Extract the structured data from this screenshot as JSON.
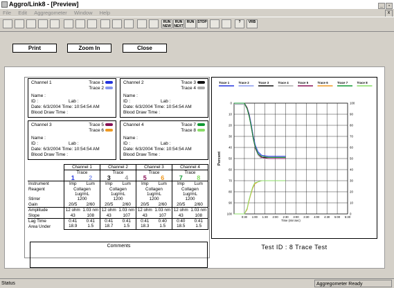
{
  "window": {
    "title": "Aggro/Link8 - [Preview]",
    "minimize": "_",
    "restore": "▫"
  },
  "menu": {
    "items": [
      "File",
      "Edit",
      "Aggregometer",
      "Window",
      "Help"
    ],
    "sys_close": "x"
  },
  "toolbar": {
    "buttons": [
      {
        "icon": "open-folder-icon",
        "label": ""
      },
      {
        "icon": "patient-icon",
        "label": ""
      },
      {
        "icon": "save-icon",
        "label": ""
      },
      {
        "icon": "preview-icon",
        "label": ""
      },
      {
        "icon": "print-icon",
        "label": ""
      },
      {
        "icon": "calc-icon",
        "label": ""
      },
      {
        "icon": "view1-icon",
        "label": ""
      },
      {
        "icon": "view2-icon",
        "label": ""
      },
      {
        "icon": "monitor-icon",
        "label": ""
      },
      {
        "icon": "window-icon",
        "label": ""
      },
      {
        "icon": "graph-icon",
        "label": ""
      },
      {
        "icon": "compare-icon",
        "label": ""
      },
      {
        "icon": "bars-icon",
        "label": ""
      },
      {
        "icon": "run-new-icon",
        "label": "RUN NEW"
      },
      {
        "icon": "run-next-icon",
        "label": "RUN NEXT"
      },
      {
        "icon": "run-icon",
        "label": "RUN"
      },
      {
        "icon": "stop-icon",
        "label": "STOP"
      },
      {
        "icon": "multi-icon",
        "label": ""
      },
      {
        "icon": "book-icon",
        "label": ""
      },
      {
        "icon": "help-icon",
        "label": "?"
      },
      {
        "icon": "vrb-icon",
        "label": "VRB"
      }
    ]
  },
  "actions": {
    "print": "Print",
    "zoom_in": "Zoom In",
    "close": "Close"
  },
  "channels": [
    {
      "title": "Channel 1",
      "traceA": "Trace 1",
      "traceB": "Trace 2",
      "colorA": "#2233dd",
      "colorB": "#8899ee",
      "name": "Name :",
      "id": "ID :",
      "lab": "Lab :",
      "date": "Date: 6/3/2004 Time: 10:54:54 AM",
      "blood": "Blood Draw Time :"
    },
    {
      "title": "Channel 2",
      "traceA": "Trace 3",
      "traceB": "Trace 4",
      "colorA": "#111111",
      "colorB": "#aaaaaa",
      "name": "Name :",
      "id": "ID :",
      "lab": "Lab :",
      "date": "Date: 6/3/2004 Time: 10:54:54 AM",
      "blood": "Blood Draw Time :"
    },
    {
      "title": "Channel 3",
      "traceA": "Trace 5",
      "traceB": "Trace 6",
      "colorA": "#881155",
      "colorB": "#ee9922",
      "name": "Name :",
      "id": "ID :",
      "lab": "Lab :",
      "date": "Date: 6/3/2004 Time: 10:54:54 AM",
      "blood": "Blood Draw Time :"
    },
    {
      "title": "Channel 4",
      "traceA": "Trace 7",
      "traceB": "Trace 8",
      "colorA": "#119933",
      "colorB": "#88dd66",
      "name": "Name :",
      "id": "ID :",
      "lab": "Lab :",
      "date": "Date: 6/3/2004 Time: 10:54:54 AM",
      "blood": "Blood Draw Time :"
    }
  ],
  "summary": {
    "headers": [
      "Channel 1",
      "Channel 2",
      "Channel 3",
      "Channel 4"
    ],
    "trace_label": "Trace",
    "trace_nums": [
      [
        "1",
        "2"
      ],
      [
        "3",
        "4"
      ],
      [
        "5",
        "6"
      ],
      [
        "7",
        "8"
      ]
    ],
    "trace_colors": [
      [
        "#2233dd",
        "#8899ee"
      ],
      [
        "#222222",
        "#999999"
      ],
      [
        "#881155",
        "#ee9922"
      ],
      [
        "#119933",
        "#88dd66"
      ]
    ],
    "row_labels": {
      "instrument": "Instrument",
      "reagent": "Reagent",
      "stirrer": "Stirrer",
      "gain": "Gain",
      "amplitude": "Amplitude",
      "slope": "Slope",
      "lag": "Lag Time",
      "area": "Area Under"
    },
    "instrument": [
      "Imp",
      "Lum"
    ],
    "reagent": "Collagen",
    "conc": "1ug/mL",
    "stirrer": "1200",
    "gain": [
      "20/5",
      "2/60"
    ],
    "amplitude": [
      [
        "12 ohm",
        "1.03 nm"
      ],
      [
        "12 ohm",
        "1.03 nm"
      ],
      [
        "12 ohm",
        "1.03 nm"
      ],
      [
        "12 ohm",
        "1.03 nm"
      ]
    ],
    "slope": [
      [
        "43",
        "108"
      ],
      [
        "43",
        "107"
      ],
      [
        "43",
        "107"
      ],
      [
        "43",
        "108"
      ]
    ],
    "lag": [
      [
        "0:41",
        "0:41"
      ],
      [
        "0:41",
        "0:41"
      ],
      [
        "0:41",
        "0:40"
      ],
      [
        "0:40",
        "0:41"
      ]
    ],
    "area": [
      [
        "18.9",
        "1.5"
      ],
      [
        "18.7",
        "1.5"
      ],
      [
        "18.3",
        "1.5"
      ],
      [
        "18.5",
        "1.5"
      ]
    ]
  },
  "comments_label": "Comments",
  "chart_data": {
    "type": "line",
    "legend": [
      "Trace 1",
      "Trace 2",
      "Trace 3",
      "Trace 4",
      "Trace 5",
      "Trace 6",
      "Trace 7",
      "Trace 8"
    ],
    "legend_colors": [
      "#2233dd",
      "#8899ee",
      "#111111",
      "#aaaaaa",
      "#881155",
      "#ee9922",
      "#119933",
      "#88dd66"
    ],
    "ylabel": "Percent",
    "xlabel": "Time (min:sec)",
    "left_ticks": [
      "0",
      "10",
      "20",
      "30",
      "40",
      "50",
      "60",
      "70",
      "80",
      "90",
      "100"
    ],
    "right_ticks": [
      "100",
      "90",
      "80",
      "70",
      "60",
      "50",
      "40",
      "30",
      "20",
      "10",
      "0"
    ],
    "x_ticks": [
      "0:30",
      "1:00",
      "1:30",
      "2:00",
      "2:30",
      "3:00",
      "3:30",
      "4:00",
      "4:30",
      "5:00",
      "5:30"
    ],
    "xlim": [
      0,
      330
    ],
    "ylim": [
      0,
      100
    ],
    "series": [
      {
        "name": "Trace 1",
        "color": "#2233dd",
        "x": [
          0,
          30,
          38,
          44,
          50,
          56,
          62,
          70,
          80,
          100,
          130,
          150
        ],
        "y": [
          0,
          0,
          4,
          10,
          19,
          30,
          38,
          44,
          47,
          48,
          48,
          48
        ]
      },
      {
        "name": "Trace 2",
        "color": "#8899ee",
        "x": [
          0,
          30,
          38,
          44,
          50,
          56,
          62,
          70,
          80,
          100,
          130,
          150
        ],
        "y": [
          1,
          1,
          5,
          11,
          20,
          31,
          39,
          45,
          48,
          49,
          49,
          49
        ]
      },
      {
        "name": "Trace 3",
        "color": "#111111",
        "x": [
          0,
          30,
          38,
          44,
          50,
          56,
          62,
          70,
          80,
          100,
          130,
          150
        ],
        "y": [
          0,
          0,
          5,
          12,
          21,
          32,
          40,
          46,
          49,
          49,
          49,
          49
        ]
      },
      {
        "name": "Trace 4",
        "color": "#aaaaaa",
        "x": [
          0,
          30,
          38,
          44,
          50,
          56,
          62,
          70,
          80,
          100,
          130,
          150
        ],
        "y": [
          1,
          1,
          5,
          12,
          22,
          33,
          41,
          47,
          50,
          50,
          50,
          50
        ]
      },
      {
        "name": "Trace 5",
        "color": "#881155",
        "x": [
          0,
          30,
          38,
          44,
          50,
          56,
          62,
          70,
          80,
          100,
          130,
          150
        ],
        "y": [
          0,
          0,
          4,
          11,
          21,
          32,
          41,
          46,
          49,
          50,
          50,
          50
        ]
      },
      {
        "name": "Trace 6",
        "color": "#ee9922",
        "x": [
          0,
          30,
          38,
          42,
          48,
          54,
          60,
          70,
          80,
          100,
          130,
          150
        ],
        "y": [
          100,
          100,
          96,
          90,
          83,
          77,
          73,
          71,
          70,
          70,
          70,
          70
        ]
      },
      {
        "name": "Trace 7",
        "color": "#119933",
        "x": [
          0,
          30,
          38,
          44,
          50,
          56,
          62,
          70,
          80,
          100,
          130,
          150
        ],
        "y": [
          0,
          0,
          5,
          12,
          21,
          32,
          40,
          46,
          48,
          49,
          49,
          49
        ]
      },
      {
        "name": "Trace 8",
        "color": "#88dd66",
        "x": [
          0,
          30,
          38,
          42,
          48,
          54,
          60,
          70,
          80,
          100,
          130,
          150
        ],
        "y": [
          100,
          100,
          95,
          89,
          82,
          76,
          72,
          71,
          70,
          70,
          70,
          70
        ]
      }
    ]
  },
  "test_id": "Test ID : 8 Trace Test",
  "status": {
    "left": "Status",
    "right": "Aggregometer Ready"
  }
}
